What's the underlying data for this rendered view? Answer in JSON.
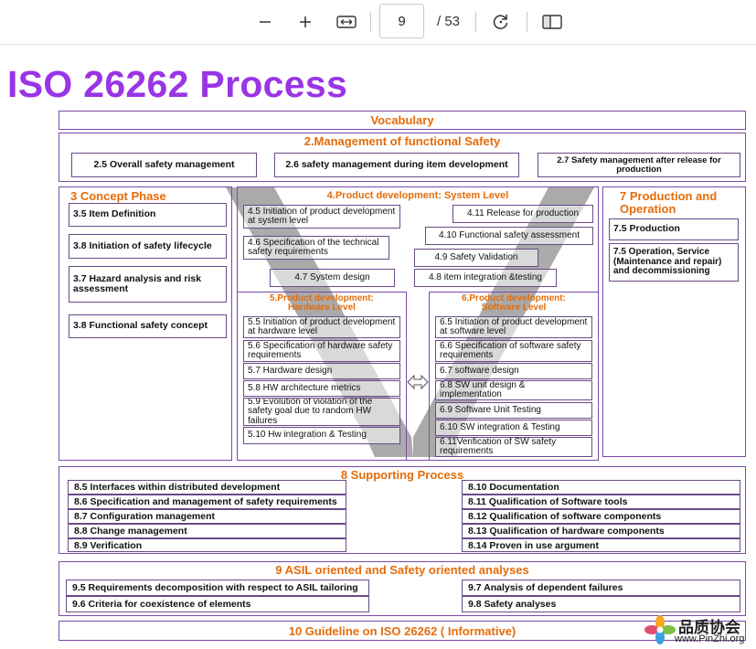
{
  "toolbar": {
    "current_page": "9",
    "total_pages": "/ 53",
    "icons": [
      "zoom-out-icon",
      "zoom-in-icon",
      "fit-width-icon",
      "rotate-icon",
      "page-view-icon"
    ]
  },
  "slide": {
    "title": "ISO 26262 Process",
    "vocabulary": "Vocabulary",
    "management": {
      "header": "2.Management of functional Safety",
      "items": [
        "2.5 Overall safety management",
        "2.6 safety management during item development",
        "2.7 Safety management after release for production"
      ]
    },
    "concept": {
      "header": "3 Concept Phase",
      "items": [
        "3.5 Item Definition",
        "3.8 Initiation of safety lifecycle",
        "3.7 Hazard analysis and risk assessment",
        "3.8 Functional safety  concept"
      ]
    },
    "system": {
      "header": "4.Product development: System Level",
      "items": [
        "4.5 Initiation of product development at system level",
        "4.6 Specification of the technical safety requirements",
        "4.7 System design",
        "4.11 Release for production",
        "4.10 Functional safety assessment",
        "4.9 Safety Validation",
        "4.8 item integration  &testing"
      ]
    },
    "hardware": {
      "header_line1": "5.Product development:",
      "header_line2": "Hardware Level",
      "items": [
        "5.5 Initiation of product development at hardware level",
        "5.6 Specification of hardware safety requirements",
        "5.7 Hardware design",
        "5.8 HW architecture metrics",
        "5.9 Evolution of violation of the safety goal due to random HW failures",
        "5.10 Hw integration  & Testing"
      ]
    },
    "software": {
      "header_line1": "6.Product development:",
      "header_line2": "Software Level",
      "items": [
        "6.5 Initiation of product development at software level",
        "6.6 Specification of software safety requirements",
        "6.7 software design",
        "6.8 SW unit design & implementation",
        "6.9 Software Unit Testing",
        "6.10 SW integration  & Testing",
        "6.11Verification of SW safety requirements"
      ]
    },
    "production": {
      "header": "7 Production  and Operation",
      "items": [
        "7.5 Production",
        "7.5 Operation, Service (Maintenance and repair) and decommissioning"
      ]
    },
    "supporting": {
      "header": "8 Supporting Process",
      "left": [
        "8.5 Interfaces  within distributed development",
        "8.6 Specification and management of safety requirements",
        "8.7 Configuration management",
        "8.8 Change management",
        "8.9 Verification"
      ],
      "right": [
        "8.10 Documentation",
        "8.11 Qualification of Software tools",
        "8.12 Qualification of software components",
        "8.13 Qualification of hardware components",
        "8.14 Proven in use argument"
      ]
    },
    "asil": {
      "header": "9 ASIL oriented and Safety oriented analyses",
      "left": [
        "9.5 Requirements decomposition with respect to ASIL tailoring",
        "9.6 Criteria for coexistence of elements"
      ],
      "right": [
        "9.7 Analysis of dependent failures",
        "9.8 Safety analyses"
      ]
    },
    "guideline": "10 Guideline on ISO 26262 ( Informative)"
  },
  "watermark": {
    "text_cn": "品质协会",
    "url": "www.PinZhi.org"
  },
  "colors": {
    "title": "#9a35e6",
    "header_orange": "#e46c0a",
    "border_purple": "#7a4aa8",
    "v_gray": "#9b9b9b"
  }
}
